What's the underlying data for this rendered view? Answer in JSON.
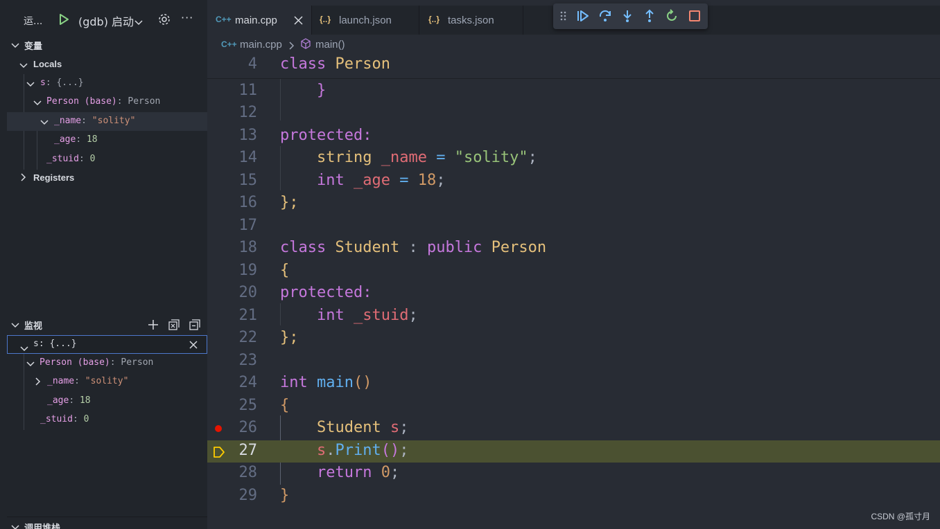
{
  "run_bar": {
    "title": "运...",
    "config": "(gdb) 启动"
  },
  "variables": {
    "header": "变量",
    "locals_label": "Locals",
    "rows": [
      {
        "name": "s",
        "sep": ": ",
        "value": "{...}"
      },
      {
        "name": "Person (base)",
        "sep": ": ",
        "value": "Person"
      },
      {
        "name": "_name",
        "sep": ": ",
        "value": "\"solity\""
      },
      {
        "name": "_age",
        "sep": ": ",
        "value": "18"
      },
      {
        "name": "_stuid",
        "sep": ": ",
        "value": "0"
      }
    ],
    "registers_label": "Registers"
  },
  "watch": {
    "header": "监视",
    "expr_name": "s",
    "expr_sep": ": ",
    "expr_value": "{...}",
    "rows": [
      {
        "name": "Person (base)",
        "sep": ": ",
        "value": "Person"
      },
      {
        "name": "_name",
        "sep": ": ",
        "value": "\"solity\""
      },
      {
        "name": "_age",
        "sep": ": ",
        "value": "18"
      },
      {
        "name": "_stuid",
        "sep": ": ",
        "value": "0"
      }
    ]
  },
  "callstack": {
    "header": "调用堆栈"
  },
  "tabs": [
    {
      "icon": "C++",
      "label": "main.cpp",
      "active": true
    },
    {
      "icon": "{..}",
      "label": "launch.json",
      "active": false
    },
    {
      "icon": "{..}",
      "label": "tasks.json",
      "active": false
    }
  ],
  "breadcrumb": {
    "file_icon": "C++",
    "file": "main.cpp",
    "symbol": "main()"
  },
  "code": {
    "sticky": {
      "num": "4",
      "kw": "class",
      "name": "Person"
    },
    "lines": [
      {
        "num": "11"
      },
      {
        "num": "12"
      },
      {
        "num": "13"
      },
      {
        "num": "14"
      },
      {
        "num": "15"
      },
      {
        "num": "16"
      },
      {
        "num": "17"
      },
      {
        "num": "18"
      },
      {
        "num": "19"
      },
      {
        "num": "20"
      },
      {
        "num": "21"
      },
      {
        "num": "22"
      },
      {
        "num": "23"
      },
      {
        "num": "24"
      },
      {
        "num": "25"
      },
      {
        "num": "26"
      },
      {
        "num": "27"
      },
      {
        "num": "28"
      },
      {
        "num": "29"
      }
    ],
    "tokens": {
      "t11": "}",
      "t13": "protected:",
      "t14_type": "string",
      "t14_var": "_name",
      "t14_eq": " = ",
      "t14_str": "\"solity\"",
      "t14_end": ";",
      "t15_type": "int",
      "t15_var": "_age",
      "t15_eq": " = ",
      "t15_num": "18",
      "t15_end": ";",
      "t16": "};",
      "t18_kw": "class",
      "t18_name": "Student",
      "t18_colon": " : ",
      "t18_pub": "public",
      "t18_base": "Person",
      "t19": "{",
      "t20": "protected:",
      "t21_type": "int",
      "t21_var": "_stuid",
      "t21_end": ";",
      "t22": "};",
      "t24_type": "int",
      "t24_fn": "main",
      "t24_paren": "()",
      "t25": "{",
      "t26_type": "Student",
      "t26_var": "s",
      "t26_end": ";",
      "t27_obj": "s",
      "t27_dot": ".",
      "t27_fn": "Print",
      "t27_paren": "()",
      "t27_end": ";",
      "t28_kw": "return",
      "t28_num": "0",
      "t28_end": ";",
      "t29": "}"
    }
  },
  "watermark": "CSDN @孤寸月"
}
